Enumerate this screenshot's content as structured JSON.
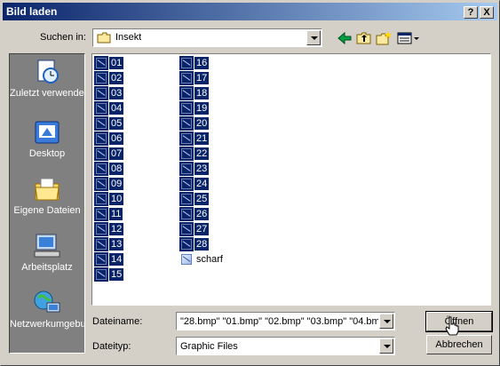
{
  "window": {
    "title": "Bild laden"
  },
  "titlebar": {
    "help_label": "?",
    "close_label": "X"
  },
  "look_in": {
    "label": "Suchen in:",
    "value": "Insekt"
  },
  "places": [
    {
      "label": "Zuletzt verwendete D...",
      "icon": "recent-icon"
    },
    {
      "label": "Desktop",
      "icon": "desktop-icon"
    },
    {
      "label": "Eigene Dateien",
      "icon": "my-documents-icon"
    },
    {
      "label": "Arbeitsplatz",
      "icon": "my-computer-icon"
    },
    {
      "label": "Netzwerkumgebung",
      "icon": "network-icon"
    }
  ],
  "files": {
    "col1": [
      "01",
      "02",
      "03",
      "04",
      "05",
      "06",
      "07",
      "08",
      "09",
      "10",
      "11",
      "12",
      "13",
      "14",
      "15"
    ],
    "col2": [
      "16",
      "17",
      "18",
      "19",
      "20",
      "21",
      "22",
      "23",
      "24",
      "25",
      "26",
      "27",
      "28",
      "scharf"
    ]
  },
  "filename": {
    "label": "Dateiname:",
    "value": "\"28.bmp\" \"01.bmp\" \"02.bmp\" \"03.bmp\" \"04.bm"
  },
  "filetype": {
    "label": "Dateityp:",
    "value": "Graphic Files"
  },
  "buttons": {
    "open": "Öffnen",
    "cancel": "Abbrechen"
  },
  "colors": {
    "selection": "#0a246a",
    "face": "#d4d0c8",
    "places_bg": "#808080"
  }
}
